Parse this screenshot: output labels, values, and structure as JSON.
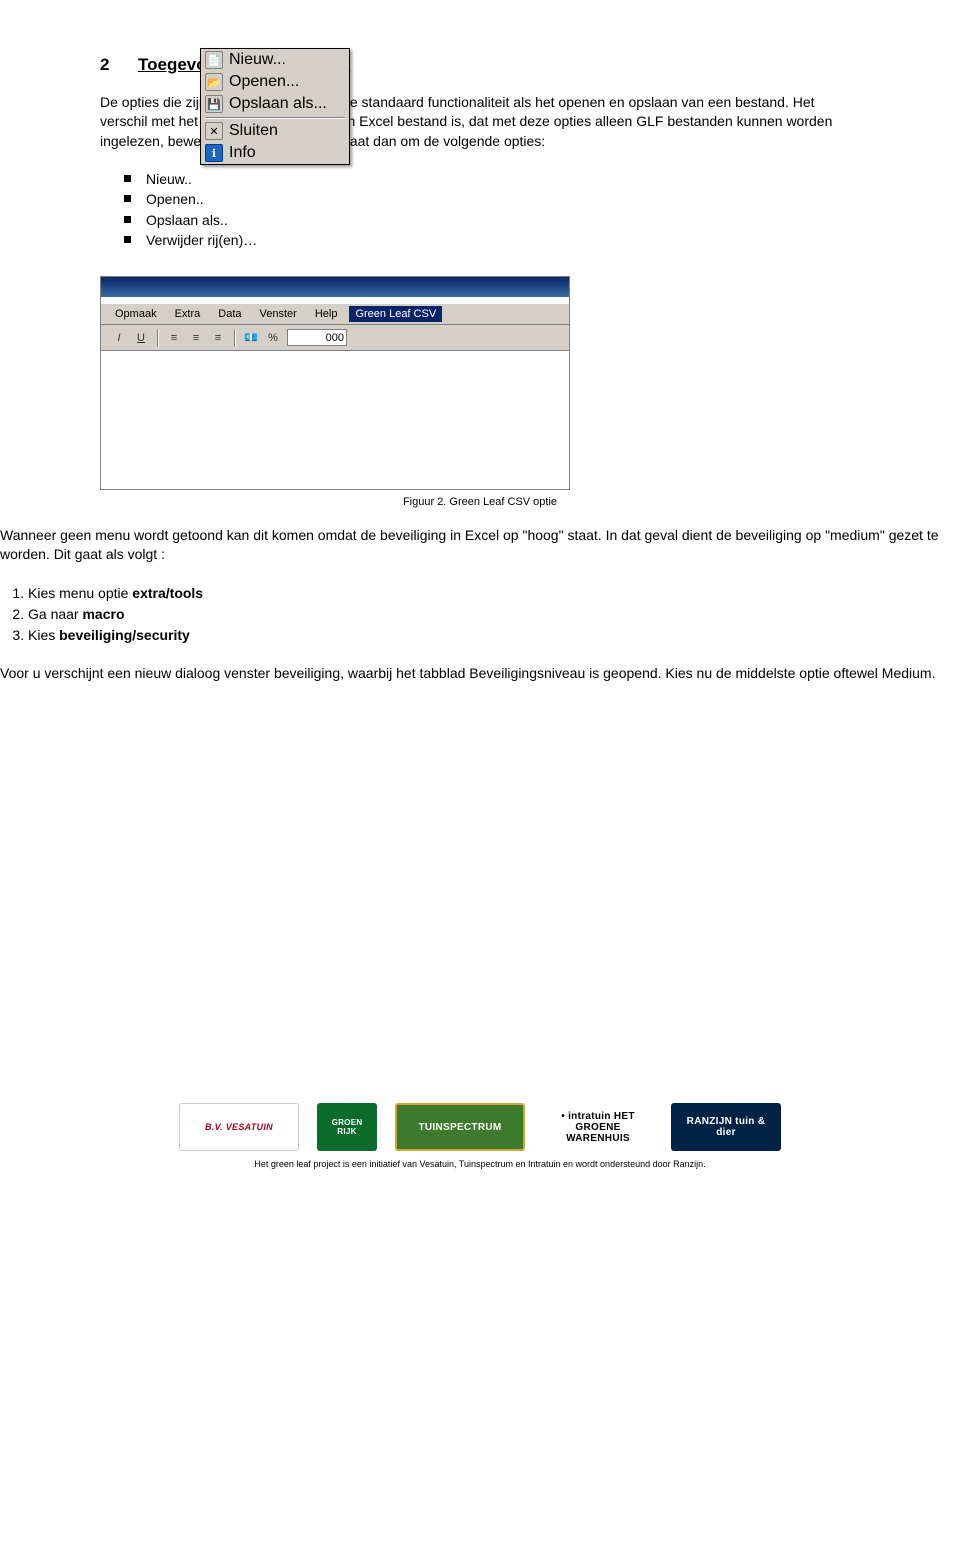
{
  "section": {
    "number": "2",
    "title": "Toegevoegde Menu opties"
  },
  "para1": "De opties die zijn toegevoegd, hebben de standaard functionaliteit als het openen en opslaan van een bestand. Het verschil met het openen van een gewoon Excel bestand is, dat met deze opties alleen GLF bestanden kunnen worden ingelezen, bewerkt of opgeslagen. Het gaat dan om de volgende opties:",
  "bullets": [
    "Nieuw..",
    "Openen..",
    "Opslaan als..",
    "Verwijder rij(en)…"
  ],
  "screenshot": {
    "menubar": [
      "Opmaak",
      "Extra",
      "Data",
      "Venster",
      "Help",
      "Green Leaf CSV"
    ],
    "menubar_highlight_index": 5,
    "toolbar": {
      "italic": "I",
      "underline": "U",
      "percent": "%",
      "zoom": "000"
    },
    "dropdown": [
      {
        "icon": "new-icon",
        "glyph": "📄",
        "label": "Nieuw..."
      },
      {
        "icon": "open-icon",
        "glyph": "📂",
        "label": "Openen..."
      },
      {
        "icon": "save-icon",
        "glyph": "💾",
        "label": "Opslaan als..."
      },
      {
        "icon": "close-icon",
        "glyph": "✕",
        "label": "Sluiten"
      },
      {
        "icon": "info-icon",
        "glyph": "ℹ",
        "label": "Info"
      }
    ]
  },
  "figure_caption": "Figuur 2. Green Leaf CSV optie",
  "para2": "Wanneer geen menu wordt getoond kan dit komen omdat de beveiliging in Excel op \"hoog\" staat. In dat geval dient de beveiliging op \"medium\" gezet te worden. Dit gaat als volgt :",
  "steps": [
    {
      "pre": "Kies menu optie ",
      "bold": "extra/tools"
    },
    {
      "pre": "Ga naar ",
      "bold": "macro"
    },
    {
      "pre": "Kies ",
      "bold": "beveiliging/security"
    }
  ],
  "para3": "Voor u verschijnt een nieuw dialoog venster beveiliging, waarbij het tabblad Beveiligingsniveau is geopend. Kies nu de middelste optie oftewel Medium.",
  "footer": {
    "logos": [
      {
        "name": "vesatuin",
        "text": "B.V. VESATUIN"
      },
      {
        "name": "groenrijk",
        "text": "GROEN RIJK"
      },
      {
        "name": "tuinspectrum",
        "text": "TUINSPECTRUM"
      },
      {
        "name": "intratuin",
        "text": "• intratuin HET GROENE WARENHUIS"
      },
      {
        "name": "ranzijn",
        "text": "RANZIJN tuin & dier"
      }
    ],
    "line": "Het green leaf project is een initiatief van Vesatuin, Tuinspectrum en Intratuin en wordt ondersteund door Ranzijn."
  }
}
